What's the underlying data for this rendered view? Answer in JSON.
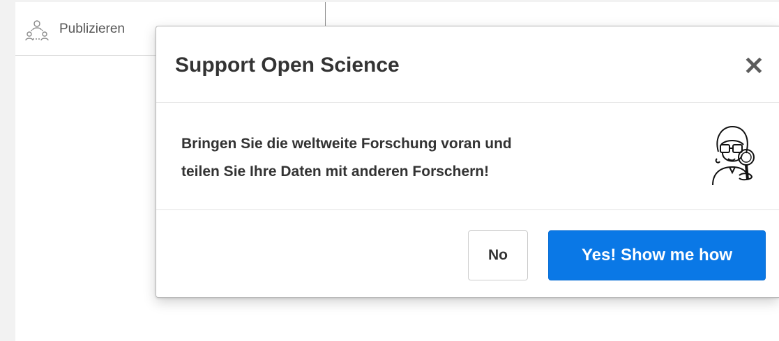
{
  "nav": {
    "publish_label": "Publizieren",
    "publish_icon": "users-network-icon"
  },
  "modal": {
    "title": "Support Open Science",
    "close_icon": "close-icon",
    "message_line1": "Bringen Sie die weltweite Forschung voran und",
    "message_line2": "teilen Sie Ihre Daten mit anderen Forschern!",
    "illustration_icon": "researcher-magnifier-icon",
    "buttons": {
      "no_label": "No",
      "yes_label": "Yes! Show me how"
    }
  },
  "colors": {
    "primary": "#0a78e6",
    "background": "#f2f2f2",
    "text": "#333333"
  }
}
